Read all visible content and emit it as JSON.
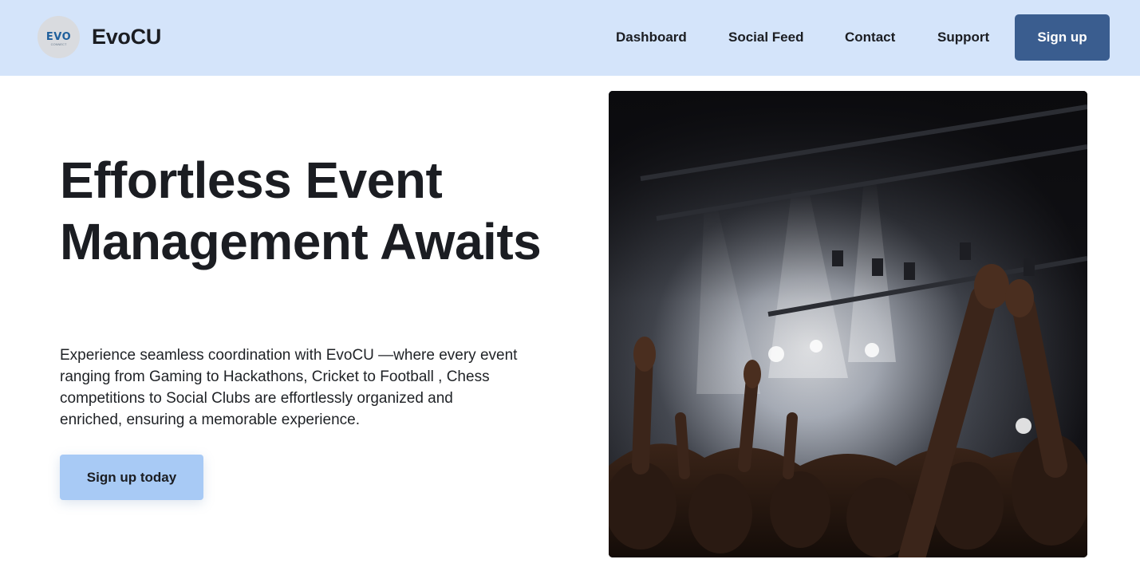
{
  "header": {
    "logo_text": "EVO",
    "logo_subtext": "CONNECT",
    "brand_name": "EvoCU",
    "nav": [
      {
        "label": "Dashboard"
      },
      {
        "label": "Social Feed"
      },
      {
        "label": "Contact"
      },
      {
        "label": "Support"
      }
    ],
    "signup_label": "Sign up"
  },
  "hero": {
    "title": "Effortless Event Management Awaits",
    "description": "Experience seamless coordination with EvoCU —where every event ranging from Gaming to Hackathons, Cricket to Football , Chess competitions to Social Clubs are effortlessly organized and enriched, ensuring a memorable experience.",
    "cta_label": "Sign up today"
  },
  "image": {
    "subject": "concert-crowd-photo"
  },
  "colors": {
    "header_bg": "#d4e4fa",
    "primary_button": "#3a5d8f",
    "cta_button": "#a8caf5",
    "text": "#1b1d22"
  }
}
